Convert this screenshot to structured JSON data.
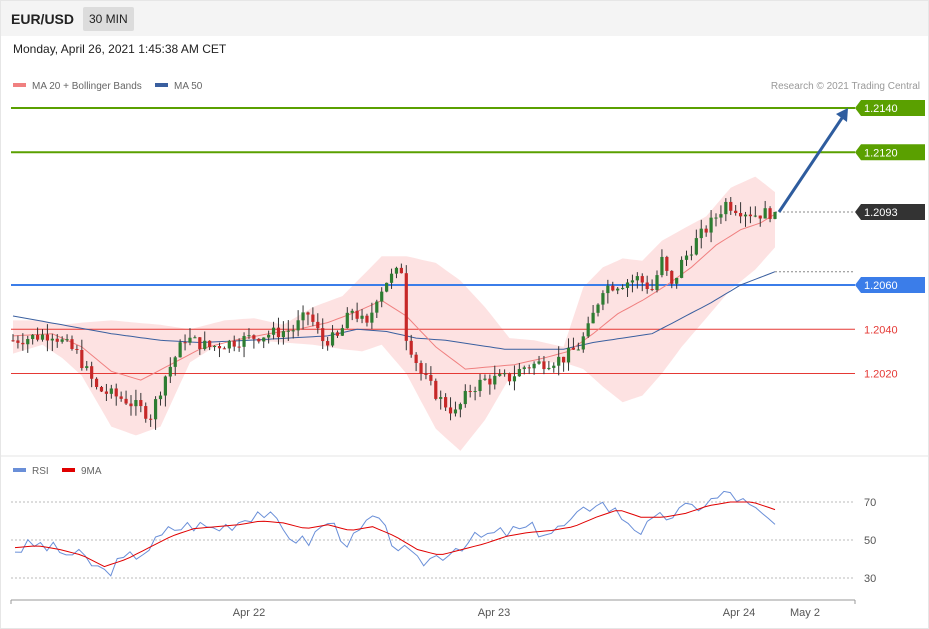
{
  "header": {
    "symbol": "EUR/USD",
    "timeframe": "30 MIN",
    "timestamp": "Monday, April 26, 2021 1:45:38 AM CET"
  },
  "legend": {
    "ma20_label": "MA 20 + Bollinger Bands",
    "ma50_label": "MA 50",
    "rsi_label": "RSI",
    "rsi_ma_label": "9MA",
    "credit": "Research © 2021 Trading Central"
  },
  "colors": {
    "ma20": "#f08080",
    "ma50": "#3a5f9f",
    "band_fill": "#fde0e0",
    "up": "#2e7d32",
    "down": "#c62828",
    "resistance": "#5aa000",
    "pivot": "#3b7de9",
    "support": "#e53935",
    "last": "#333333",
    "arrow": "#2e5c9e",
    "rsi": "#6a8fd8",
    "rsi_ma": "#e00000"
  },
  "chart_data": [
    {
      "type": "candlestick",
      "title": "EUR/USD",
      "timeframe": "30 MIN",
      "x_ticks": [
        "Apr 22",
        "Apr 23",
        "Apr 24",
        "May 2"
      ],
      "ylim": [
        1.1953,
        1.2156
      ],
      "last_price": 1.2093,
      "target_price": 1.214,
      "levels": [
        {
          "value": 1.214,
          "label": "1.2140",
          "kind": "resistance"
        },
        {
          "value": 1.212,
          "label": "1.2120",
          "kind": "resistance"
        },
        {
          "value": 1.2093,
          "label": "1.2093",
          "kind": "last"
        },
        {
          "value": 1.206,
          "label": "1.2060",
          "kind": "pivot"
        },
        {
          "value": 1.204,
          "label": "1.2040",
          "kind": "support"
        },
        {
          "value": 1.202,
          "label": "1.2020",
          "kind": "support"
        }
      ],
      "close_path": [
        [
          0,
          1.2035
        ],
        [
          8,
          1.2038
        ],
        [
          13,
          1.2029
        ],
        [
          17,
          1.2013
        ],
        [
          23,
          1.2008
        ],
        [
          28,
          1.2001
        ],
        [
          31,
          1.2019
        ],
        [
          35,
          1.2036
        ],
        [
          40,
          1.2032
        ],
        [
          44,
          1.2034
        ],
        [
          50,
          1.2037
        ],
        [
          57,
          1.204
        ],
        [
          60,
          1.2047
        ],
        [
          63,
          1.2035
        ],
        [
          66,
          1.2036
        ],
        [
          69,
          1.2049
        ],
        [
          72,
          1.2041
        ],
        [
          74,
          1.2055
        ],
        [
          76,
          1.2062
        ],
        [
          79,
          1.2067
        ],
        [
          80,
          1.2037
        ],
        [
          83,
          1.202
        ],
        [
          87,
          1.2008
        ],
        [
          90,
          1.2002
        ],
        [
          93,
          1.2013
        ],
        [
          96,
          1.2017
        ],
        [
          101,
          1.2018
        ],
        [
          104,
          1.2023
        ],
        [
          108,
          1.2025
        ],
        [
          112,
          1.2027
        ],
        [
          115,
          1.2032
        ],
        [
          117,
          1.204
        ],
        [
          120,
          1.2059
        ],
        [
          124,
          1.2061
        ],
        [
          127,
          1.2063
        ],
        [
          130,
          1.2058
        ],
        [
          132,
          1.2071
        ],
        [
          134,
          1.2059
        ],
        [
          136,
          1.207
        ],
        [
          139,
          1.208
        ],
        [
          142,
          1.2088
        ],
        [
          145,
          1.2097
        ],
        [
          148,
          1.2094
        ],
        [
          151,
          1.2092
        ],
        [
          155,
          1.2093
        ]
      ],
      "bands_path": [
        [
          0,
          1.2044,
          1.2029
        ],
        [
          6,
          1.2044,
          1.2033
        ],
        [
          10,
          1.2042,
          1.2027
        ],
        [
          14,
          1.2043,
          1.2019
        ],
        [
          20,
          1.2044,
          1.1996
        ],
        [
          25,
          1.2043,
          1.1992
        ],
        [
          30,
          1.2042,
          1.1996
        ],
        [
          36,
          1.204,
          1.2025
        ],
        [
          43,
          1.2044,
          1.2035
        ],
        [
          49,
          1.2045,
          1.2035
        ],
        [
          55,
          1.2042,
          1.2034
        ],
        [
          61,
          1.205,
          1.2033
        ],
        [
          67,
          1.2055,
          1.2031
        ],
        [
          71,
          1.2064,
          1.203
        ],
        [
          75,
          1.2073,
          1.2033
        ],
        [
          80,
          1.2073,
          1.202
        ],
        [
          86,
          1.207,
          1.1995
        ],
        [
          91,
          1.2062,
          1.1985
        ],
        [
          96,
          1.205,
          1.1999
        ],
        [
          101,
          1.2036,
          1.2018
        ],
        [
          106,
          1.2035,
          1.2025
        ],
        [
          112,
          1.2032,
          1.2025
        ],
        [
          116,
          1.2059,
          1.2022
        ],
        [
          120,
          1.2068,
          1.2014
        ],
        [
          124,
          1.2072,
          1.2007
        ],
        [
          128,
          1.2071,
          1.201
        ],
        [
          132,
          1.208,
          1.202
        ],
        [
          136,
          1.2085,
          1.2032
        ],
        [
          141,
          1.2091,
          1.2045
        ],
        [
          146,
          1.2104,
          1.2058
        ],
        [
          151,
          1.2109,
          1.2067
        ],
        [
          155,
          1.2102,
          1.2077
        ]
      ],
      "ma20_path": [
        [
          0,
          1.2037
        ],
        [
          8,
          1.2038
        ],
        [
          14,
          1.2032
        ],
        [
          20,
          1.2021
        ],
        [
          26,
          1.2017
        ],
        [
          32,
          1.2024
        ],
        [
          38,
          1.2031
        ],
        [
          45,
          1.2035
        ],
        [
          52,
          1.2038
        ],
        [
          58,
          1.204
        ],
        [
          64,
          1.2043
        ],
        [
          70,
          1.2048
        ],
        [
          75,
          1.2053
        ],
        [
          80,
          1.2046
        ],
        [
          86,
          1.2032
        ],
        [
          92,
          1.2022
        ],
        [
          97,
          1.2023
        ],
        [
          102,
          1.2024
        ],
        [
          108,
          1.2027
        ],
        [
          113,
          1.203
        ],
        [
          118,
          1.2038
        ],
        [
          123,
          1.2047
        ],
        [
          128,
          1.2053
        ],
        [
          133,
          1.206
        ],
        [
          138,
          1.2068
        ],
        [
          143,
          1.2078
        ],
        [
          148,
          1.2085
        ],
        [
          152,
          1.2088
        ],
        [
          155,
          1.2092
        ]
      ],
      "ma50_path": [
        [
          0,
          1.2046
        ],
        [
          10,
          1.2042
        ],
        [
          20,
          1.2038
        ],
        [
          30,
          1.2035
        ],
        [
          38,
          1.2034
        ],
        [
          48,
          1.2035
        ],
        [
          56,
          1.2036
        ],
        [
          64,
          1.2037
        ],
        [
          70,
          1.204
        ],
        [
          76,
          1.2039
        ],
        [
          82,
          1.2036
        ],
        [
          88,
          1.2035
        ],
        [
          94,
          1.2033
        ],
        [
          100,
          1.2031
        ],
        [
          106,
          1.2031
        ],
        [
          112,
          1.2031
        ],
        [
          118,
          1.2034
        ],
        [
          124,
          1.2036
        ],
        [
          130,
          1.2038
        ],
        [
          136,
          1.2045
        ],
        [
          142,
          1.2052
        ],
        [
          148,
          1.206
        ],
        [
          155,
          1.2066
        ]
      ]
    },
    {
      "type": "line",
      "title": "RSI",
      "series": [
        {
          "name": "RSI",
          "values": [
            45,
            48,
            44,
            41,
            33,
            40,
            46,
            56,
            58,
            56,
            60,
            66,
            55,
            48,
            60,
            48,
            62,
            48,
            38,
            42,
            48,
            52,
            54,
            56,
            54,
            60,
            71,
            64,
            55,
            62,
            66,
            70,
            75,
            66,
            58
          ]
        },
        {
          "name": "9MA",
          "values": [
            46,
            47,
            45,
            42,
            36,
            40,
            46,
            52,
            56,
            57,
            58,
            60,
            59,
            56,
            58,
            55,
            57,
            52,
            45,
            42,
            45,
            48,
            52,
            54,
            55,
            57,
            62,
            66,
            62,
            62,
            64,
            68,
            70,
            70,
            66
          ]
        }
      ],
      "ylim": [
        20,
        80
      ],
      "y_ticks": [
        70,
        50,
        30
      ],
      "reference_lines": [
        70,
        50,
        30
      ]
    }
  ]
}
